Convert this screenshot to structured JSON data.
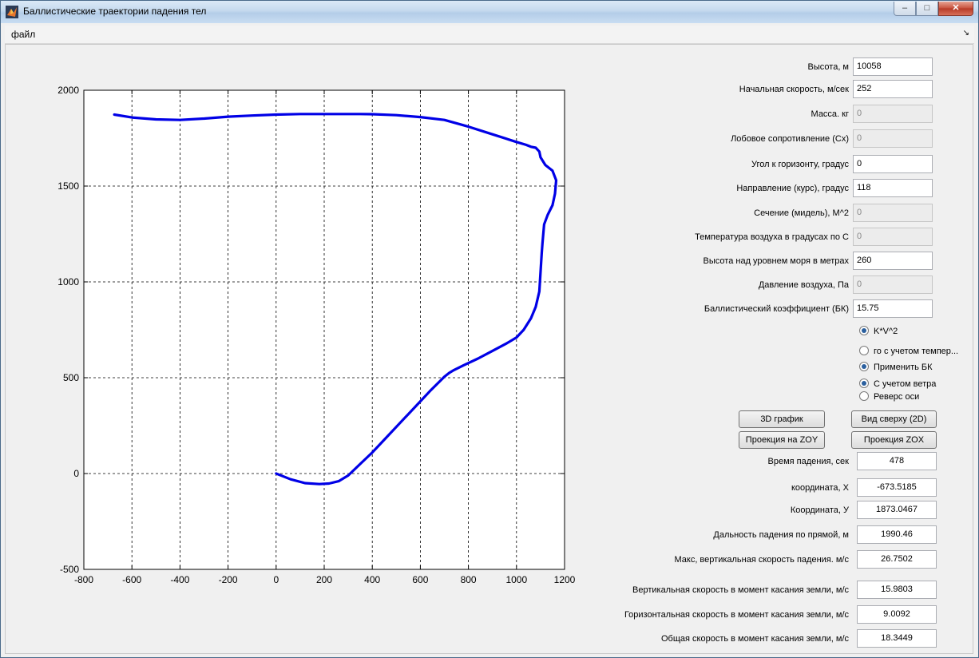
{
  "window": {
    "title": "Баллистические траектории падения тел",
    "min": "–",
    "max": "□",
    "close": "✕"
  },
  "menu": {
    "file": "файл",
    "arrow": "↘"
  },
  "inputs": [
    {
      "label": "Высота, м",
      "value": "10058",
      "enabled": true
    },
    {
      "label": "Начальная скорость, м/сек",
      "value": "252",
      "enabled": true
    },
    {
      "label": "Масса. кг",
      "value": "0",
      "enabled": false
    },
    {
      "label": "Лобовое сопротивление (Сх)",
      "value": "0",
      "enabled": false
    },
    {
      "label": "Угол к горизонту, градус",
      "value": "0",
      "enabled": true
    },
    {
      "label": "Направление  (курс), градус",
      "value": "118",
      "enabled": true
    },
    {
      "label": "Сечение (мидель), М^2",
      "value": "0",
      "enabled": false
    },
    {
      "label": "Температура воздуха в градусах по С",
      "value": "0",
      "enabled": false
    },
    {
      "label": "Высота над уровнем моря в метрах",
      "value": "260",
      "enabled": true
    },
    {
      "label": "Давление воздуха, Па",
      "value": "0",
      "enabled": false
    },
    {
      "label": "Баллистический коэффициент (БК)",
      "value": "15.75",
      "enabled": true
    }
  ],
  "radios": [
    {
      "label": "K*V^2",
      "checked": true
    },
    {
      "label": "го с учетом темпер...",
      "checked": false
    },
    {
      "label": "Применить БК",
      "checked": true
    },
    {
      "label": "С учетом ветра",
      "checked": true
    },
    {
      "label": "Реверс оси",
      "checked": false
    }
  ],
  "buttons": {
    "graph3d": "3D график",
    "top_view": "Вид сверху (2D)",
    "proj_zoy": "Проекция на ZOY",
    "proj_zox": "Проекция ZOX"
  },
  "outputs": [
    {
      "label": "Время падения, сек",
      "value": "478"
    },
    {
      "label": "координата, X",
      "value": "-673.5185"
    },
    {
      "label": "Координата, У",
      "value": "1873.0467"
    },
    {
      "label": "Дальность падения по прямой, м",
      "value": "1990.46"
    },
    {
      "label": "Макс,  вертикальная скорость падения. м/с",
      "value": "26.7502"
    },
    {
      "label": "Вертикальная  скорость в момент касания земли, м/с",
      "value": "15.9803"
    },
    {
      "label": "Горизонтальная скорость в момент касания земли, м/с",
      "value": "9.0092"
    },
    {
      "label": "Общая скорость в момент касания земли, м/с",
      "value": "18.3449"
    }
  ],
  "chart_data": {
    "type": "line",
    "xlim": [
      -800,
      1200
    ],
    "ylim": [
      -500,
      2000
    ],
    "xticks": [
      "-800",
      "-600",
      "-400",
      "-200",
      "0",
      "200",
      "400",
      "600",
      "800",
      "1000",
      "1200"
    ],
    "yticks": [
      "-500",
      "0",
      "500",
      "1000",
      "1500",
      "2000"
    ],
    "grid": true,
    "color": "#0000e6",
    "series": [
      {
        "x": [
          0,
          60,
          120,
          180,
          220,
          260,
          300,
          350,
          400,
          460,
          520,
          580,
          640,
          680,
          700,
          720,
          740,
          780,
          840,
          900,
          960,
          1000,
          1030,
          1060,
          1080,
          1095,
          1100,
          1105,
          1108,
          1115,
          1130,
          1150,
          1160,
          1165,
          1150,
          1120,
          1100,
          1095,
          1080,
          1060,
          1040,
          1000,
          900,
          800,
          700,
          600,
          500,
          400,
          350,
          300,
          200,
          100,
          0,
          -100,
          -200,
          -300,
          -400,
          -500,
          -600,
          -673.5
        ],
        "y": [
          0,
          -30,
          -50,
          -55,
          -52,
          -40,
          -10,
          50,
          110,
          190,
          270,
          350,
          430,
          480,
          505,
          525,
          540,
          565,
          600,
          640,
          680,
          710,
          750,
          810,
          870,
          950,
          1050,
          1150,
          1200,
          1300,
          1350,
          1400,
          1460,
          1530,
          1580,
          1610,
          1650,
          1680,
          1700,
          1705,
          1715,
          1730,
          1770,
          1810,
          1845,
          1860,
          1870,
          1875,
          1876,
          1876,
          1876,
          1876,
          1873,
          1868,
          1862,
          1852,
          1845,
          1848,
          1858,
          1873
        ]
      }
    ]
  }
}
